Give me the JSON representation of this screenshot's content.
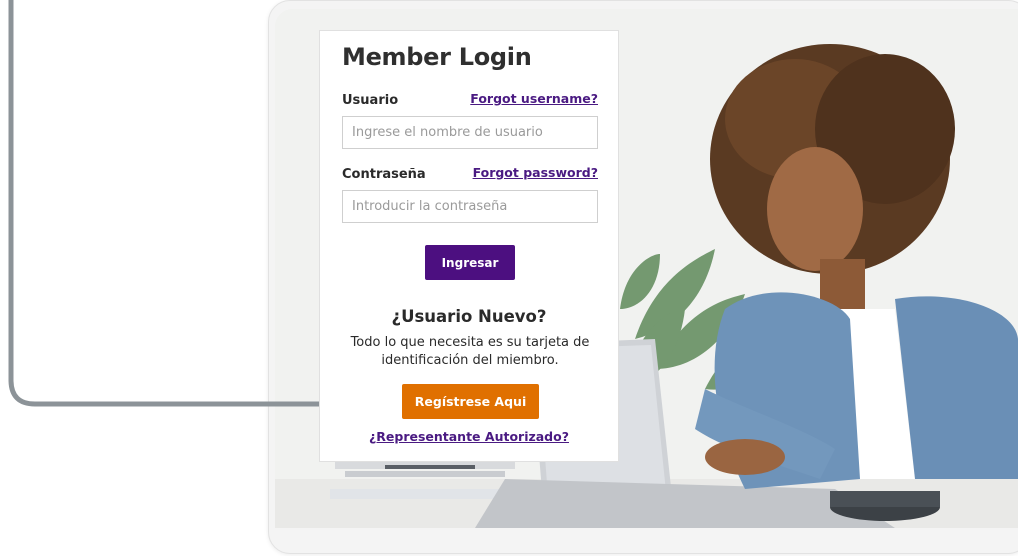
{
  "login": {
    "title": "Member Login",
    "username_label": "Usuario",
    "forgot_username": "Forgot username?",
    "username_placeholder": "Ingrese el nombre de usuario",
    "password_label": "Contraseña",
    "forgot_password": "Forgot password?",
    "password_placeholder": "Introducir la contraseña",
    "submit_label": "Ingresar"
  },
  "new_user": {
    "heading": "¿Usuario Nuevo?",
    "description": "Todo lo que necesita es su tarjeta de identificación del miembro.",
    "register_label": "Regístrese Aqui",
    "authorized_rep_link": "¿Representante Autorizado?"
  },
  "colors": {
    "primary_purple": "#4c0f80",
    "link_purple": "#4a1a82",
    "register_orange": "#e07000",
    "callout_arrow": "#8c9398"
  },
  "icons": [
    "callout-arrow-icon"
  ]
}
